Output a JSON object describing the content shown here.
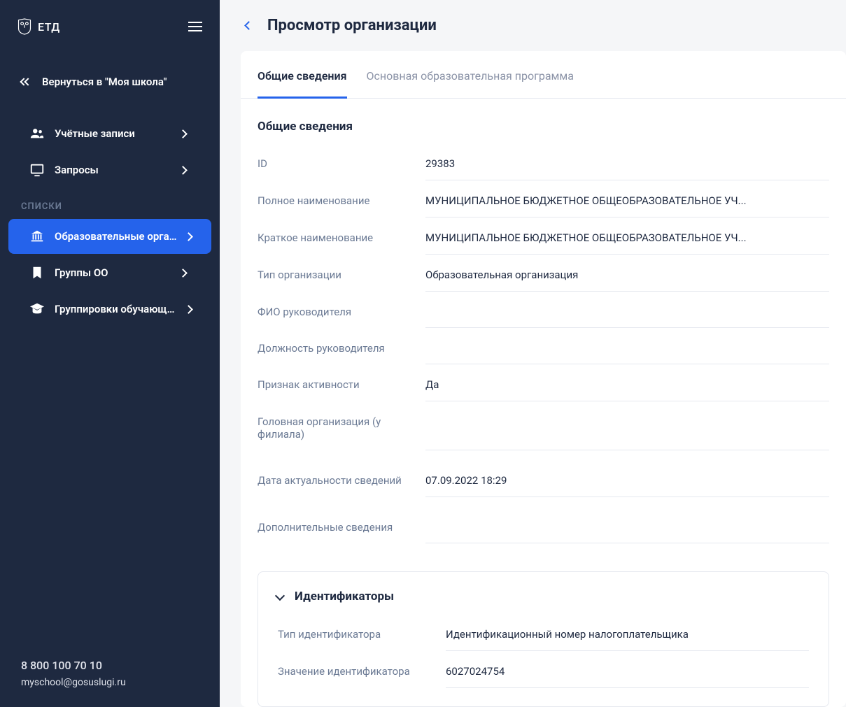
{
  "brand": "ЕТД",
  "sidebar": {
    "back_link": "Вернуться в \"Моя школа\"",
    "nav": {
      "accounts": "Учётные записи",
      "requests": "Запросы"
    },
    "lists_header": "СПИСКИ",
    "lists": {
      "edu_orgs": "Образовательные организа...",
      "oo_groups": "Группы ОО",
      "student_groups": "Группировки обучающихся"
    },
    "footer": {
      "phone": "8 800 100 70 10",
      "email": "myschool@gosuslugi.ru"
    }
  },
  "page": {
    "title": "Просмотр организации",
    "tabs": {
      "general": "Общие сведения",
      "program": "Основная образовательная программа"
    },
    "section_heading": "Общие сведения",
    "fields": {
      "id": {
        "label": "ID",
        "value": "29383"
      },
      "full_name": {
        "label": "Полное наименование",
        "value": "МУНИЦИПАЛЬНОЕ БЮДЖЕТНОЕ ОБЩЕОБРАЗОВАТЕЛЬНОЕ УЧ..."
      },
      "short_name": {
        "label": "Краткое наименование",
        "value": "МУНИЦИПАЛЬНОЕ БЮДЖЕТНОЕ ОБЩЕОБРАЗОВАТЕЛЬНОЕ УЧ..."
      },
      "org_type": {
        "label": "Тип организации",
        "value": "Образовательная организация"
      },
      "head_name": {
        "label": "ФИО руководителя",
        "value": ""
      },
      "head_position": {
        "label": "Должность руководителя",
        "value": ""
      },
      "active": {
        "label": "Признак активности",
        "value": "Да"
      },
      "parent_org": {
        "label": "Головная организация (у филиала)",
        "value": ""
      },
      "actual_date": {
        "label": "Дата актуальности сведений",
        "value": "07.09.2022 18:29"
      },
      "additional": {
        "label": "Дополнительные сведения",
        "value": ""
      }
    },
    "identifiers": {
      "heading": "Идентификаторы",
      "id_type": {
        "label": "Тип идентификатора",
        "value": "Идентификационный номер налогоплательщика"
      },
      "id_value": {
        "label": "Значение идентификатора",
        "value": "6027024754"
      }
    }
  }
}
